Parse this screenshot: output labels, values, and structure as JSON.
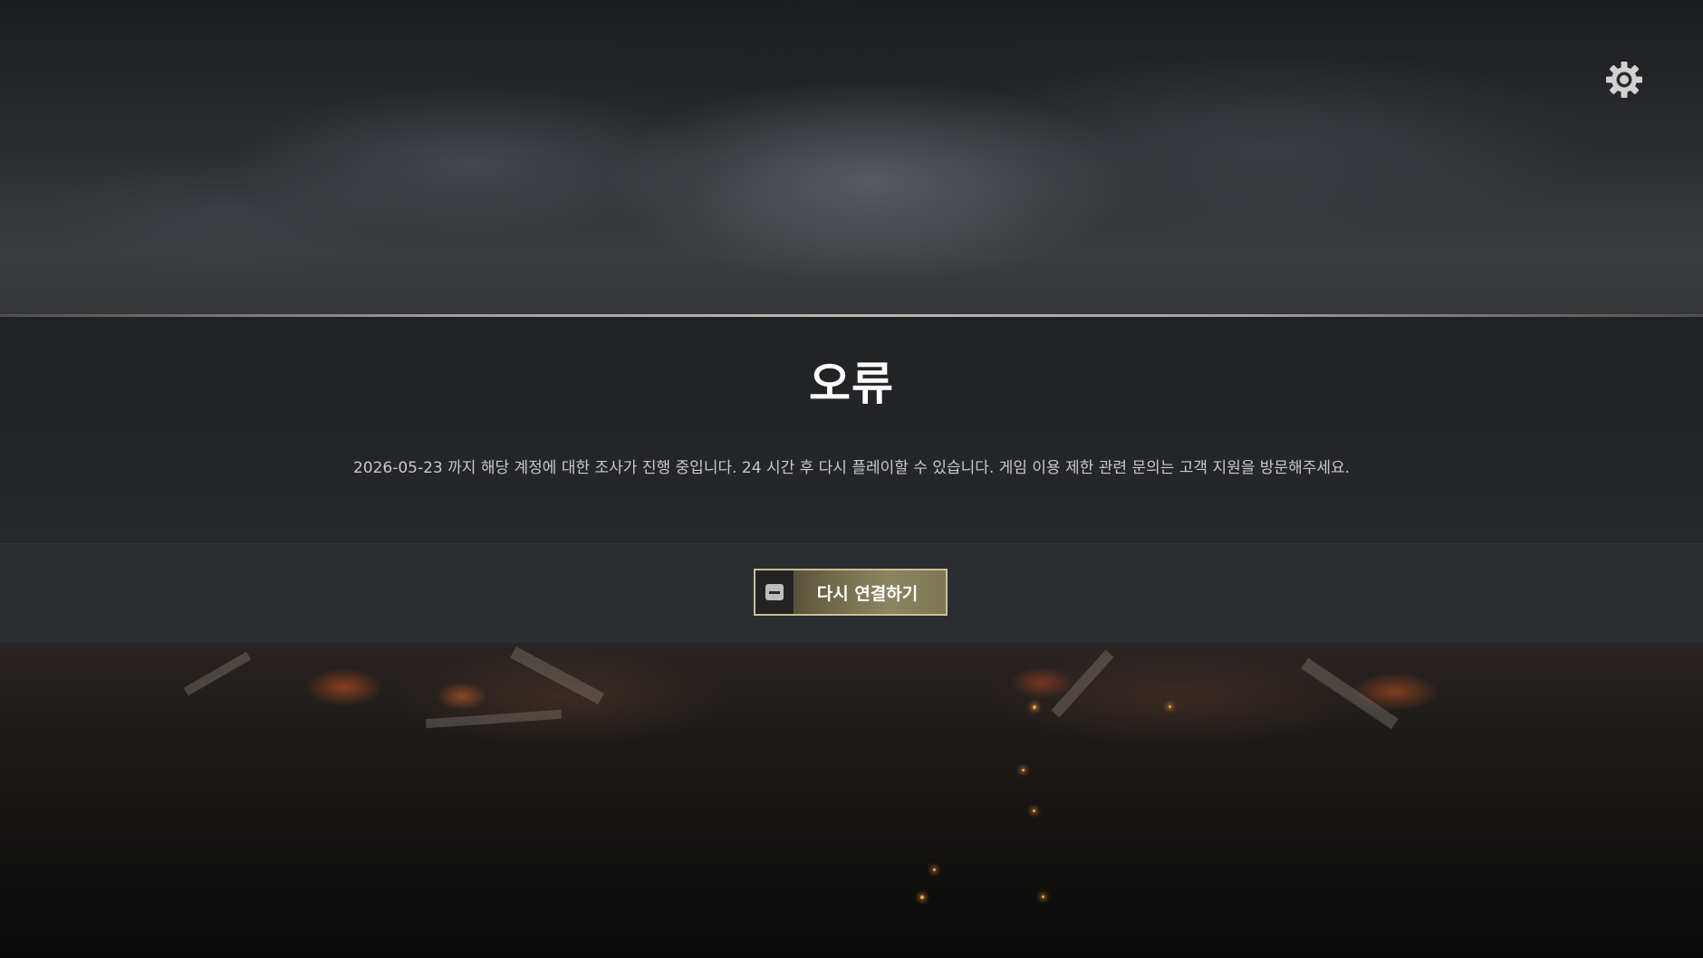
{
  "dialog": {
    "title": "오류",
    "message": "2026-05-23 까지 해당 계정에 대한 조사가 진행 중입니다. 24 시간 후 다시 플레이할 수 있습니다. 게임 이용 제한 관련 문의는 고객 지원을 방문해주세요.",
    "reconnect_label": "다시 연결하기",
    "reconnect_key_icon": "keyboard-key-icon"
  },
  "settings": {
    "icon": "gear-icon"
  },
  "colors": {
    "accent_gold": "#c8bd95",
    "title_text": "#ffffff",
    "message_text": "#c9c9c9",
    "panel_bg": "#26282b",
    "footer_bg": "#2c2d30"
  }
}
